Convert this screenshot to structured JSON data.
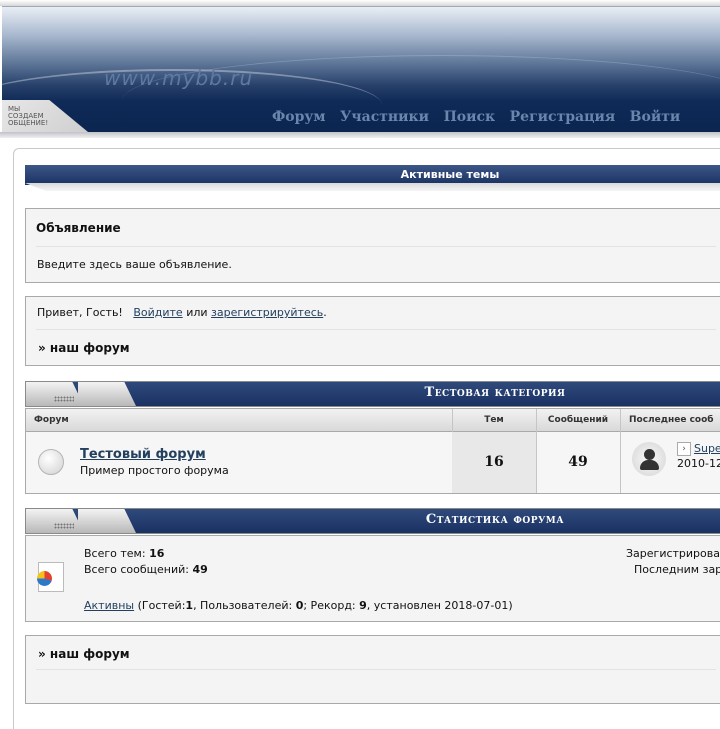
{
  "header": {
    "site_name": "www.mybb.ru",
    "slogan": "МЫ СОЗДАЕМ ОБЩЕНИЕ!",
    "nav": [
      "Форум",
      "Участники",
      "Поиск",
      "Регистрация",
      "Войти"
    ]
  },
  "active_topics": {
    "label": "Активные темы"
  },
  "announcement": {
    "title": "Объявление",
    "text": "Введите здесь ваше объявление."
  },
  "welcome": {
    "greeting": "Привет, Гость!",
    "login_link": "Войдите",
    "or": "или",
    "register_link": "зарегистрируйтесь",
    "end": ".",
    "crumb": "» наш форум"
  },
  "category": {
    "title": "Тестовая категория",
    "columns": [
      "Форум",
      "Тем",
      "Сообщений",
      "Последнее сооб"
    ],
    "forum": {
      "name": "Тестовый форум",
      "description": "Пример простого форума",
      "topics": "16",
      "posts": "49",
      "last_user": "Supe",
      "last_date": "2010-12"
    }
  },
  "stats": {
    "title": "Статистика форума",
    "topics_label": "Всего тем:",
    "topics_value": "16",
    "posts_label": "Всего сообщений:",
    "posts_value": "49",
    "registered_label": "Зарегистрирова",
    "last_registered_label": "Последним зар",
    "online_link": "Активны",
    "online_open": "(Гостей:",
    "guests": "1",
    "users_label": ", Пользователей:",
    "users": "0",
    "record_label": "; Рекорд:",
    "record": "9",
    "record_date": ", установлен 2018-07-01)"
  },
  "footer": {
    "crumb": "» наш форум"
  }
}
